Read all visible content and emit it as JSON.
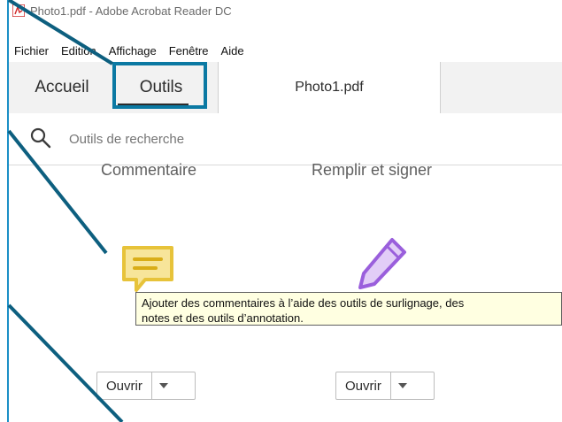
{
  "window": {
    "title": "Photo1.pdf - Adobe Acrobat Reader DC"
  },
  "menu": {
    "items": [
      {
        "label": "Fichier"
      },
      {
        "label": "Edition"
      },
      {
        "label": "Affichage"
      },
      {
        "label": "Fenêtre"
      },
      {
        "label": "Aide"
      }
    ]
  },
  "tabs": {
    "home": "Accueil",
    "tools": "Outils",
    "document": "Photo1.pdf"
  },
  "search": {
    "placeholder": "Outils de recherche"
  },
  "tools": [
    {
      "name": "Commentaire",
      "open_label": "Ouvrir"
    },
    {
      "name": "Remplir et signer",
      "open_label": "Ouvrir"
    }
  ],
  "tooltip": {
    "line1": "Ajouter des commentaires à l’aide des outils de surlignage, des",
    "line2": "notes et des outils d’annotation."
  },
  "colors": {
    "highlight_border": "#0b79a3",
    "comment_icon": "#e7c33a",
    "pen_icon": "#9a5fdc",
    "tooltip_bg": "#ffffe1"
  }
}
